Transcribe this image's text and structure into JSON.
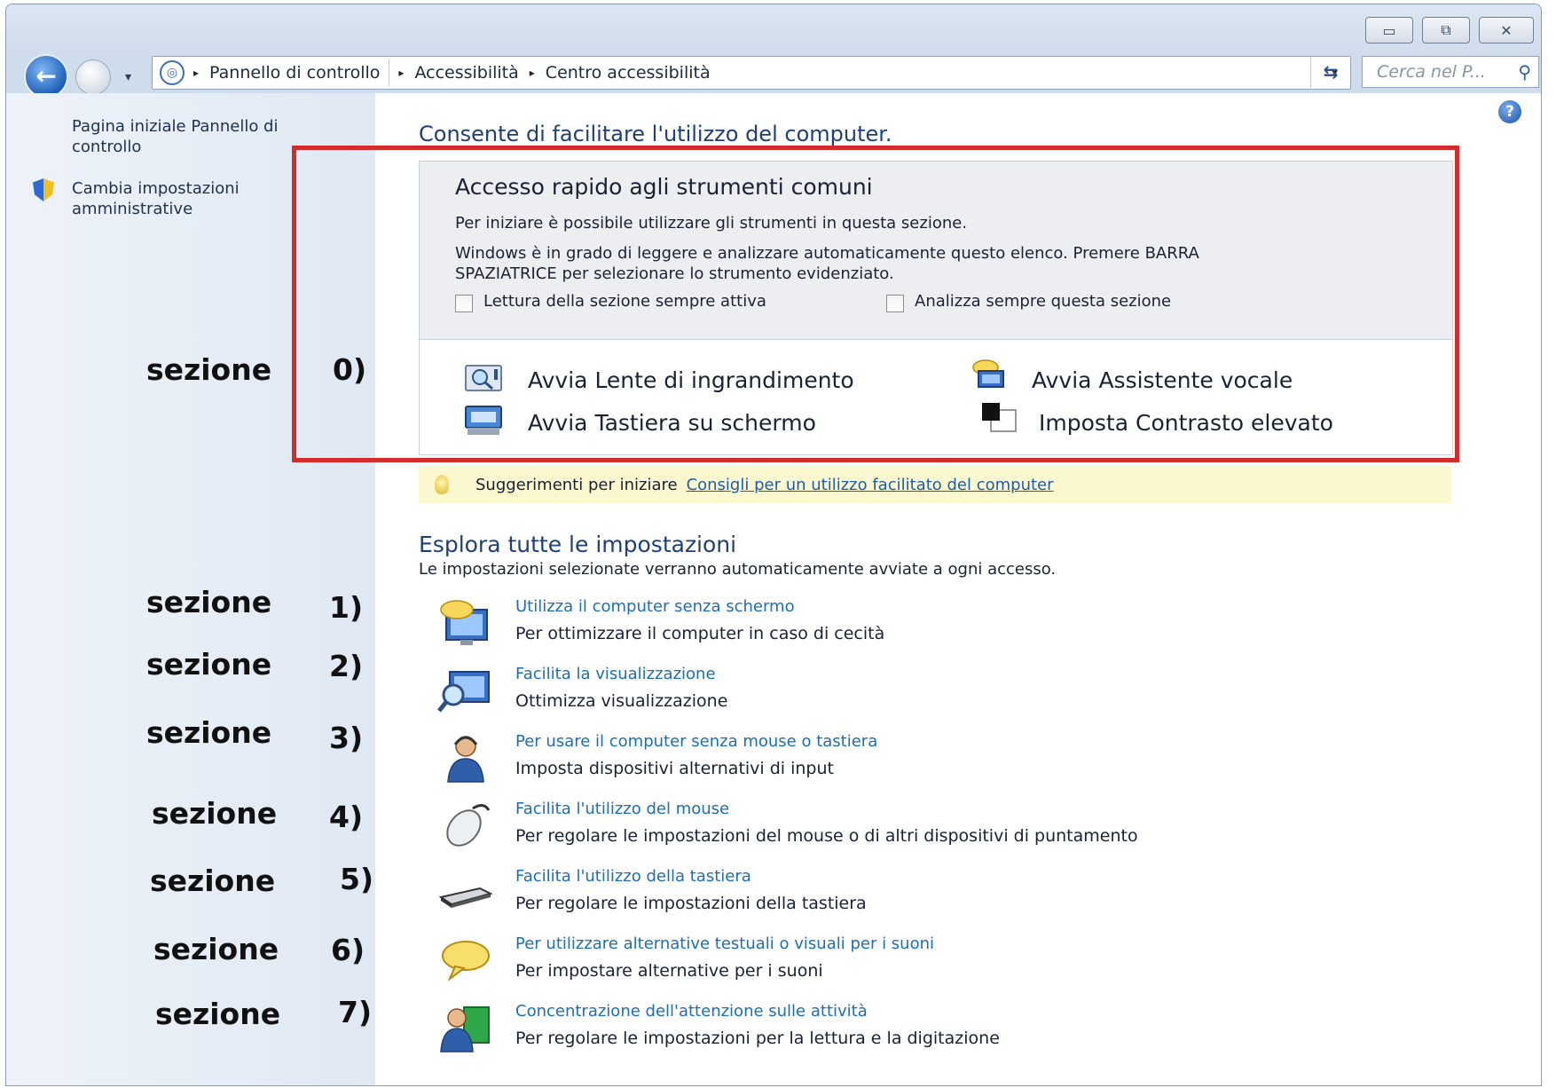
{
  "window": {
    "caption_min": "▭",
    "caption_max": "⧉",
    "caption_close": "✕"
  },
  "navigation": {
    "back_glyph": "←",
    "history_glyph": "▾",
    "breadcrumb": [
      "Pannello di controllo",
      "Accessibilità",
      "Centro accessibilità"
    ],
    "separator": "▸",
    "dropdown_glyph": "▾",
    "refresh_glyph": "⇆",
    "search_placeholder": "Cerca nel P...",
    "search_glyph": "⚲"
  },
  "sidebar": {
    "home_link": "Pagina iniziale Pannello di controllo",
    "admin_link": "Cambia impostazioni amministrative"
  },
  "annotations": {
    "word": "sezione",
    "labels": [
      "0)",
      "1)",
      "2)",
      "3)",
      "4)",
      "5)",
      "6)",
      "7)"
    ]
  },
  "main": {
    "help_glyph": "?",
    "heading": "Consente di facilitare l'utilizzo del computer.",
    "quick_access": {
      "title": "Accesso rapido agli strumenti comuni",
      "line1": "Per iniziare è possibile utilizzare gli strumenti in questa sezione.",
      "line2": "Windows è in grado di leggere e analizzare automaticamente questo elenco. Premere BARRA",
      "line3": "SPAZIATRICE per selezionare lo strumento evidenziato.",
      "checkbox_read": "Lettura della sezione sempre attiva",
      "checkbox_scan": "Analizza sempre questa sezione",
      "tools": [
        {
          "label": "Avvia Lente di ingrandimento",
          "icon": "magnifier-icon"
        },
        {
          "label": "Avvia Assistente vocale",
          "icon": "narrator-icon"
        },
        {
          "label": "Avvia Tastiera su schermo",
          "icon": "onscreen-keyboard-icon"
        },
        {
          "label": "Imposta Contrasto elevato",
          "icon": "high-contrast-icon"
        }
      ]
    },
    "tips": {
      "label": "Suggerimenti per iniziare",
      "link": "Consigli per un utilizzo facilitato del computer"
    },
    "explore": {
      "title": "Esplora tutte le impostazioni",
      "subtitle": "Le impostazioni selezionate verranno automaticamente avviate a ogni accesso.",
      "items": [
        {
          "link": "Utilizza il computer senza schermo",
          "desc": "Per ottimizzare il computer in caso di cecità",
          "icon": "monitor-speech-icon"
        },
        {
          "link": "Facilita la visualizzazione",
          "desc": "Ottimizza visualizzazione",
          "icon": "monitor-magnifier-icon"
        },
        {
          "link": "Per usare il computer senza mouse o tastiera",
          "desc": "Imposta dispositivi alternativi di input",
          "icon": "user-headset-icon"
        },
        {
          "link": "Facilita l'utilizzo del mouse",
          "desc": "Per regolare le impostazioni del mouse o di altri dispositivi di puntamento",
          "icon": "mouse-icon"
        },
        {
          "link": "Facilita l'utilizzo della tastiera",
          "desc": "Per regolare le impostazioni della tastiera",
          "icon": "keyboard-icon"
        },
        {
          "link": "Per utilizzare alternative testuali o visuali per i suoni",
          "desc": "Per impostare alternative per i suoni",
          "icon": "speech-bubble-icon"
        },
        {
          "link": "Concentrazione dell'attenzione sulle attività",
          "desc": "Per regolare le impostazioni per la lettura e la digitazione",
          "icon": "user-book-icon"
        }
      ]
    }
  },
  "colors": {
    "annotation_frame": "#d62b2b",
    "link": "#1d6db8",
    "heading": "#1e3f78"
  }
}
